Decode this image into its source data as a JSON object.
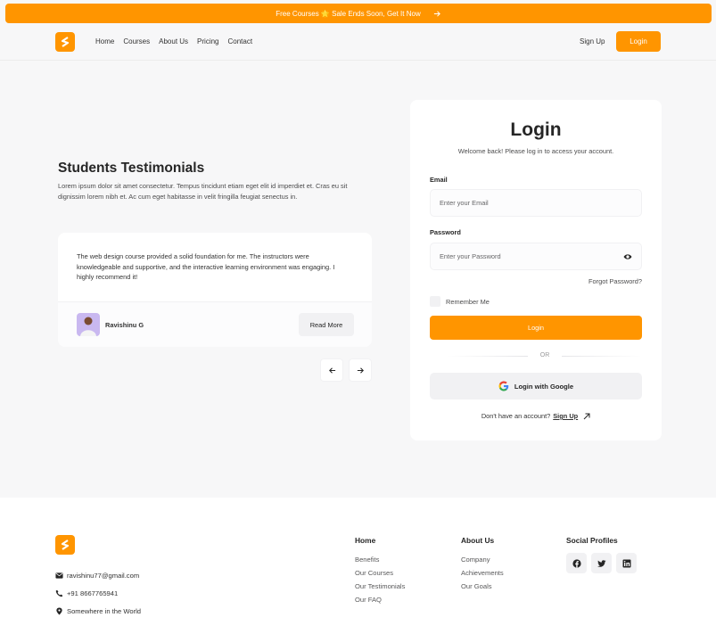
{
  "colors": {
    "accent": "#ff9500",
    "page_bg": "#f7f7f8",
    "text": "#262626"
  },
  "banner": {
    "text": "Free Courses 🌟 Sale Ends Soon, Get It Now"
  },
  "nav": {
    "links": [
      "Home",
      "Courses",
      "About Us",
      "Pricing",
      "Contact"
    ],
    "signup": "Sign Up",
    "login": "Login"
  },
  "testimonials": {
    "title": "Students Testimonials",
    "description": "Lorem ipsum dolor sit amet consectetur. Tempus tincidunt etiam eget elit id imperdiet et. Cras eu sit dignissim lorem nibh et. Ac cum eget habitasse in velit fringilla feugiat senectus in.",
    "quote": "The web design course provided a solid foundation for me. The instructors were knowledgeable and supportive, and the interactive learning environment was engaging. I highly recommend it!",
    "author": "Ravishinu G",
    "read_more": "Read More"
  },
  "login_form": {
    "title": "Login",
    "subtitle": "Welcome back! Please log in to access your account.",
    "email_label": "Email",
    "email_placeholder": "Enter your Email",
    "password_label": "Password",
    "password_placeholder": "Enter your Password",
    "forgot": "Forgot Password?",
    "remember": "Remember Me",
    "submit": "Login",
    "or": "OR",
    "google": "Login with Google",
    "no_account": "Don't have an account?",
    "signup": "Sign Up"
  },
  "footer": {
    "email": "ravishinu77@gmail.com",
    "phone": "+91 8667765941",
    "location": "Somewhere in the World",
    "col_home": {
      "title": "Home",
      "items": [
        "Benefits",
        "Our Courses",
        "Our Testimonials",
        "Our FAQ"
      ]
    },
    "col_about": {
      "title": "About Us",
      "items": [
        "Company",
        "Achievements",
        "Our Goals"
      ]
    },
    "col_social": {
      "title": "Social Profiles",
      "icons": [
        "facebook-icon",
        "twitter-icon",
        "linkedin-icon"
      ]
    }
  }
}
